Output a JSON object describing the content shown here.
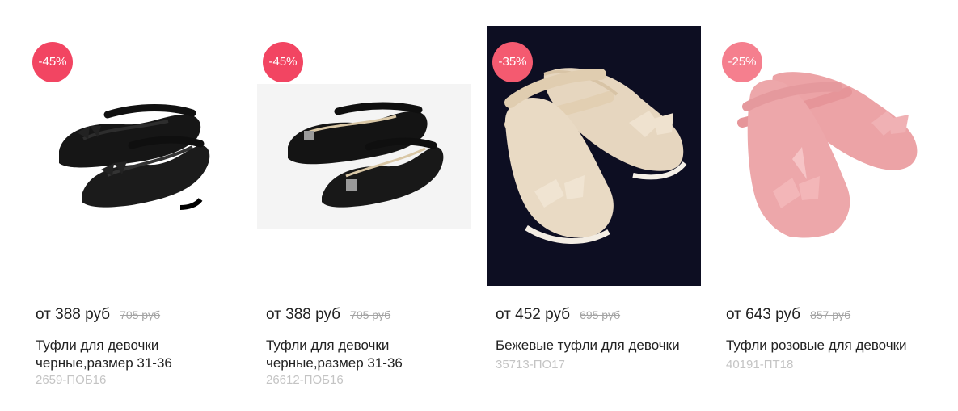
{
  "products": [
    {
      "discount": "-45%",
      "price": "от 388 руб",
      "old_price": "705 руб",
      "title": "Туфли для девочки черные,размер 31-36",
      "sku": "2659-ПОБ16",
      "colors": {
        "badge": "#f24562",
        "shoe": "#141414",
        "bg": "#ffffff"
      }
    },
    {
      "discount": "-45%",
      "price": "от 388 руб",
      "old_price": "705 руб",
      "title": "Туфли для девочки черные,размер 31-36",
      "sku": "26612-ПОБ16",
      "colors": {
        "badge": "#f24562",
        "shoe": "#141414",
        "bg": "#ffffff"
      }
    },
    {
      "discount": "-35%",
      "price": "от 452 руб",
      "old_price": "695 руб",
      "title": "Бежевые туфли для девочки",
      "sku": "35713-ПО17",
      "colors": {
        "badge": "#f45a70",
        "shoe": "#e8d8c2",
        "bg": "#0d0e22"
      }
    },
    {
      "discount": "-25%",
      "price": "от 643 руб",
      "old_price": "857 руб",
      "title": "Туфли розовые для девочки",
      "sku": "40191-ПТ18",
      "colors": {
        "badge": "#f57f8e",
        "shoe": "#eca2a5",
        "bg": "#ffffff"
      }
    }
  ]
}
